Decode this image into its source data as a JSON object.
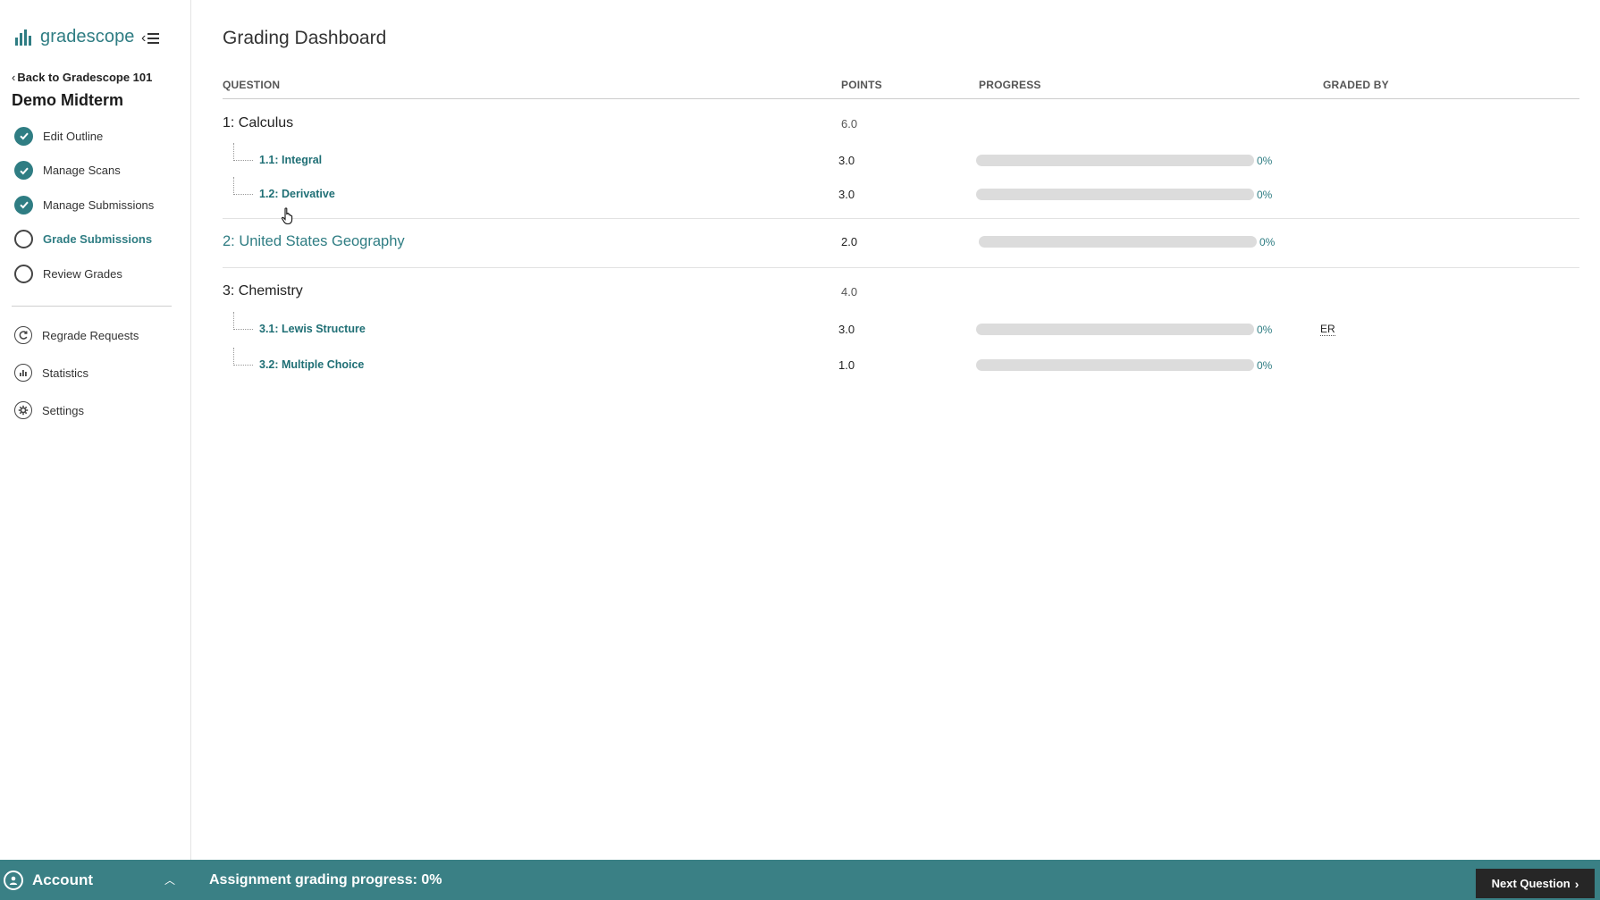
{
  "brand": {
    "name": "gradescope"
  },
  "sidebar": {
    "back_label": "Back to Gradescope 101",
    "assignment_title": "Demo Midterm",
    "steps": [
      {
        "label": "Edit Outline",
        "status": "done"
      },
      {
        "label": "Manage Scans",
        "status": "done"
      },
      {
        "label": "Manage Submissions",
        "status": "done"
      },
      {
        "label": "Grade Submissions",
        "status": "active"
      },
      {
        "label": "Review Grades",
        "status": "todo"
      }
    ],
    "tools": [
      {
        "label": "Regrade Requests",
        "icon": "regrade-icon"
      },
      {
        "label": "Statistics",
        "icon": "statistics-icon"
      },
      {
        "label": "Settings",
        "icon": "gear-icon"
      }
    ]
  },
  "main": {
    "title": "Grading Dashboard",
    "columns": {
      "question": "QUESTION",
      "points": "POINTS",
      "progress": "PROGRESS",
      "graded_by": "GRADED BY"
    },
    "questions": [
      {
        "title": "1: Calculus",
        "points": "6.0",
        "subs": [
          {
            "title": "1.1: Integral",
            "points": "3.0",
            "progress": 0,
            "pct": "0%",
            "graded_by": ""
          },
          {
            "title": "1.2: Derivative",
            "points": "3.0",
            "progress": 0,
            "pct": "0%",
            "graded_by": ""
          }
        ]
      },
      {
        "title": "2: United States Geography",
        "points": "2.0",
        "progress": 0,
        "pct": "0%",
        "graded_by": ""
      },
      {
        "title": "3: Chemistry",
        "points": "4.0",
        "subs": [
          {
            "title": "3.1: Lewis Structure",
            "points": "3.0",
            "progress": 0,
            "pct": "0%",
            "graded_by": "ER"
          },
          {
            "title": "3.2: Multiple Choice",
            "points": "1.0",
            "progress": 0,
            "pct": "0%",
            "graded_by": ""
          }
        ]
      }
    ]
  },
  "footer": {
    "account_label": "Account",
    "grading_progress": "Assignment grading progress: 0%",
    "next_label": "Next Question"
  },
  "colors": {
    "accent": "#2f7d83",
    "footer": "#3a8085",
    "button_dark": "#262626",
    "bar_track": "#dcdcdc"
  }
}
